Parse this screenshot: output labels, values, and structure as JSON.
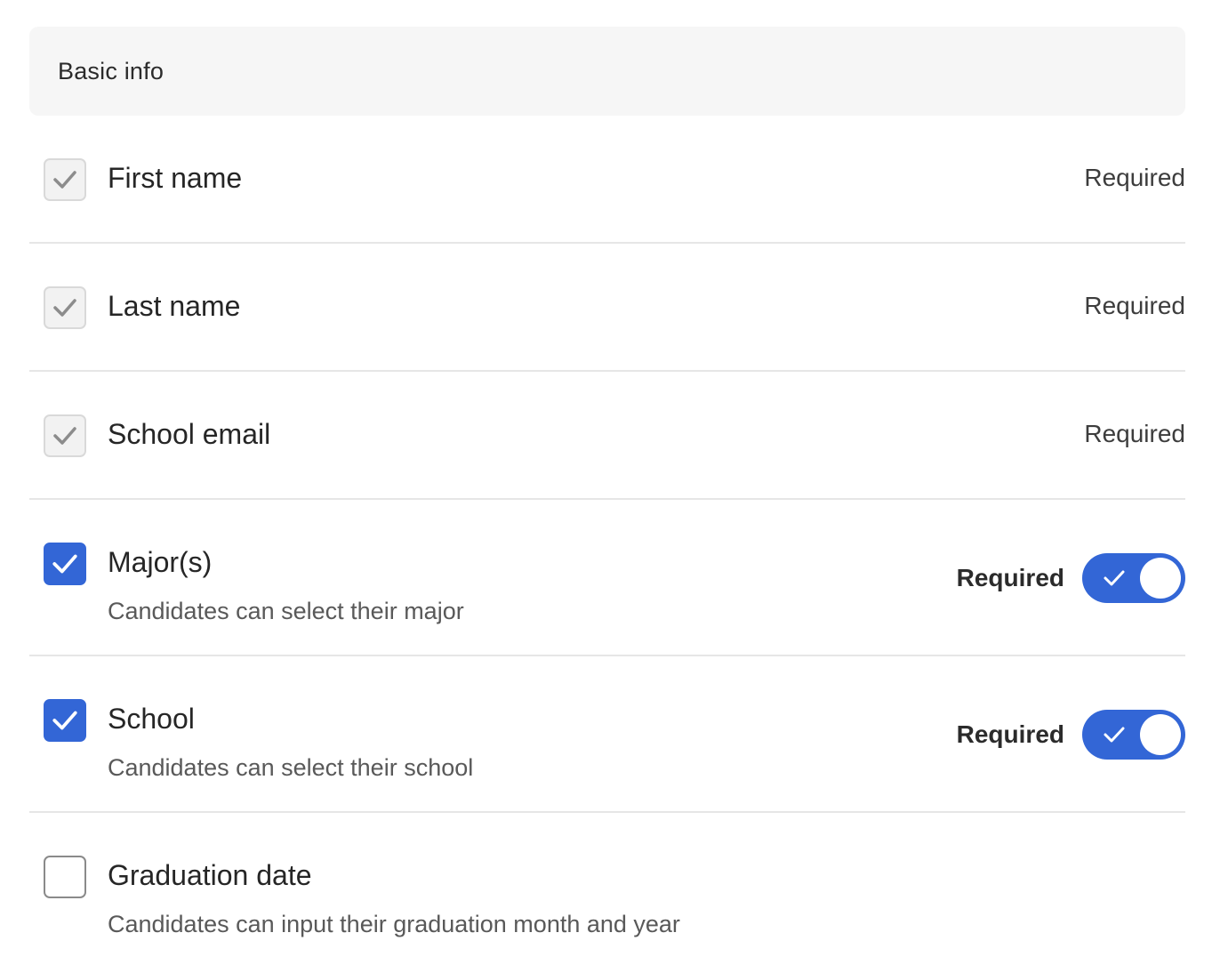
{
  "section": {
    "title": "Basic info"
  },
  "fields": [
    {
      "label": "First name",
      "required_label": "Required",
      "state": "checked-disabled"
    },
    {
      "label": "Last name",
      "required_label": "Required",
      "state": "checked-disabled"
    },
    {
      "label": "School email",
      "required_label": "Required",
      "state": "checked-disabled"
    },
    {
      "label": "Major(s)",
      "description": "Candidates can select their major",
      "required_label": "Required",
      "state": "checked",
      "required_toggle": "on"
    },
    {
      "label": "School",
      "description": "Candidates can select their school",
      "required_label": "Required",
      "state": "checked",
      "required_toggle": "on"
    },
    {
      "label": "Graduation date",
      "description": "Candidates can input their graduation month and year",
      "state": "unchecked"
    }
  ],
  "colors": {
    "accent": "#3366d6",
    "header_bg": "#f6f6f6",
    "divider": "#e6e6e6"
  }
}
